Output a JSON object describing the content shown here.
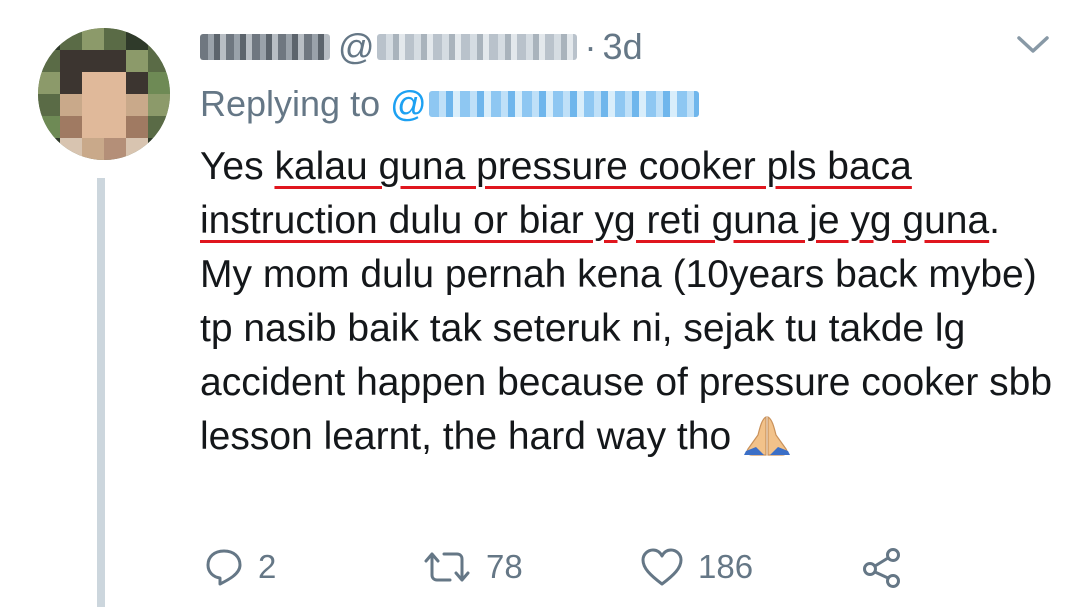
{
  "tweet": {
    "display_name": "",
    "handle_prefix": "@",
    "separator": "·",
    "time": "3d",
    "replying_label": "Replying to",
    "replying_at": "@",
    "text_intro": "Yes ",
    "text_underlined_1": "kalau guna pressure cooker pls baca instruction dulu or biar yg reti guna je yg guna",
    "text_rest": ". My mom dulu pernah kena (10years back mybe) tp nasib baik tak seteruk ni, sejak tu takde lg accident happen because of pressure cooker sbb lesson learnt, the hard way tho",
    "emoji": "folded-hands-icon"
  },
  "actions": {
    "reply_count": "2",
    "retweet_count": "78",
    "like_count": "186"
  },
  "colors": {
    "text": "#14171a",
    "muted": "#657786",
    "link": "#1da1f2",
    "underline": "#e0161e",
    "thread_line": "#ccd6dd"
  }
}
